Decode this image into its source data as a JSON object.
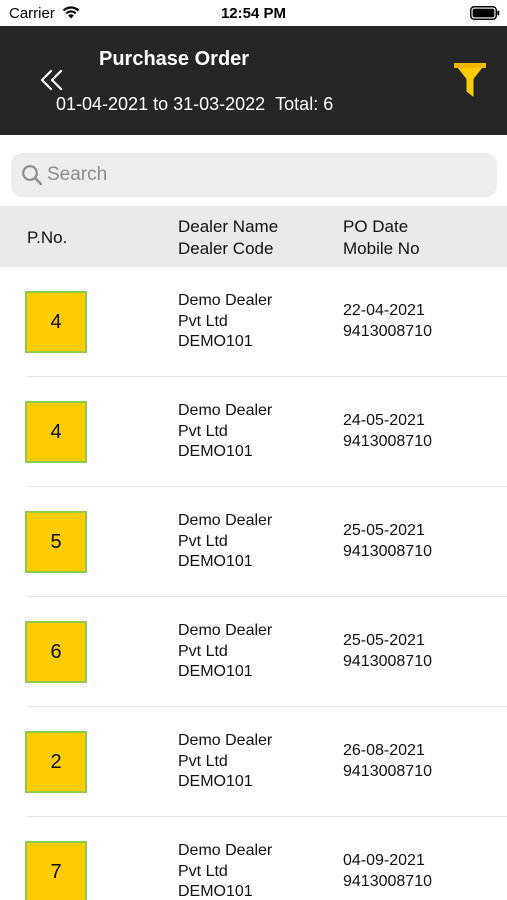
{
  "status_bar": {
    "carrier": "Carrier",
    "time": "12:54 PM"
  },
  "header": {
    "title": "Purchase Order",
    "date_range": "01-04-2021 to 31-03-2022",
    "total": "Total: 6",
    "back_icon": "double-chevron-left-icon",
    "filter_icon": "funnel-filter-icon",
    "background_color": "#262626",
    "filter_color": "#fecc00"
  },
  "search": {
    "placeholder": "Search",
    "value": ""
  },
  "columns": {
    "pno": "P.No.",
    "dealer_name": "Dealer Name",
    "dealer_code": "Dealer Code",
    "po_date": "PO Date",
    "mobile_no": "Mobile No"
  },
  "badge": {
    "fill_color": "#fecc00",
    "border_color": "#8ccd4e"
  },
  "orders": [
    {
      "pno": "4",
      "dealer_line1": "Demo Dealer",
      "dealer_line2": "Pvt Ltd",
      "dealer_code": "DEMO101",
      "po_date": "22-04-2021",
      "mobile": "9413008710"
    },
    {
      "pno": "4",
      "dealer_line1": "Demo Dealer",
      "dealer_line2": "Pvt Ltd",
      "dealer_code": "DEMO101",
      "po_date": "24-05-2021",
      "mobile": "9413008710"
    },
    {
      "pno": "5",
      "dealer_line1": "Demo Dealer",
      "dealer_line2": "Pvt Ltd",
      "dealer_code": "DEMO101",
      "po_date": "25-05-2021",
      "mobile": "9413008710"
    },
    {
      "pno": "6",
      "dealer_line1": "Demo Dealer",
      "dealer_line2": "Pvt Ltd",
      "dealer_code": "DEMO101",
      "po_date": "25-05-2021",
      "mobile": "9413008710"
    },
    {
      "pno": "2",
      "dealer_line1": "Demo Dealer",
      "dealer_line2": "Pvt Ltd",
      "dealer_code": "DEMO101",
      "po_date": "26-08-2021",
      "mobile": "9413008710"
    },
    {
      "pno": "7",
      "dealer_line1": "Demo Dealer",
      "dealer_line2": "Pvt Ltd",
      "dealer_code": "DEMO101",
      "po_date": "04-09-2021",
      "mobile": "9413008710"
    }
  ]
}
